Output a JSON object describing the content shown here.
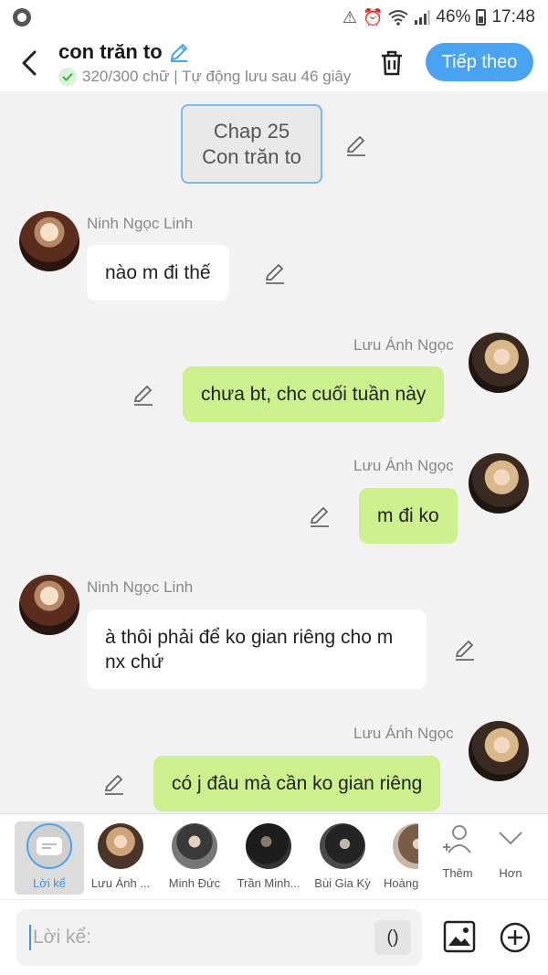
{
  "status_bar": {
    "battery": "46%",
    "time": "17:48"
  },
  "header": {
    "title": "con trăn to",
    "subtitle": "320/300 chữ | Tự động lưu sau 46 giây",
    "next_label": "Tiếp theo"
  },
  "chapter": {
    "line1": "Chap 25",
    "line2": "Con trăn to"
  },
  "messages": [
    {
      "side": "left",
      "sender": "Ninh Ngọc Linh",
      "text": "nào m đi thế"
    },
    {
      "side": "right",
      "sender": "Lưu Ánh Ngọc",
      "text": "chưa bt, chc cuối tuần này"
    },
    {
      "side": "right",
      "sender": "Lưu Ánh Ngọc",
      "text": "m đi ko"
    },
    {
      "side": "left",
      "sender": "Ninh Ngọc Linh",
      "text": "à thôi phải để ko gian riêng cho m nx chứ"
    },
    {
      "side": "right",
      "sender": "Lưu Ánh Ngọc",
      "text": "có j đâu mà cần ko gian riêng"
    }
  ],
  "characters": [
    {
      "label": "Lời kể",
      "selected": true
    },
    {
      "label": "Lưu Ánh ..."
    },
    {
      "label": "Minh Đức"
    },
    {
      "label": "Trần Minh..."
    },
    {
      "label": "Bùi Gia Kỳ"
    },
    {
      "label": "Hoàng"
    }
  ],
  "char_actions": {
    "add_label": "Thêm",
    "more_label": "Hơn"
  },
  "composer": {
    "placeholder": "Lời kể:",
    "paren_label": "()"
  },
  "colors": {
    "accent": "#4aa3f0",
    "outgoing_bubble": "#cdf08f",
    "incoming_bubble": "#ffffff"
  }
}
